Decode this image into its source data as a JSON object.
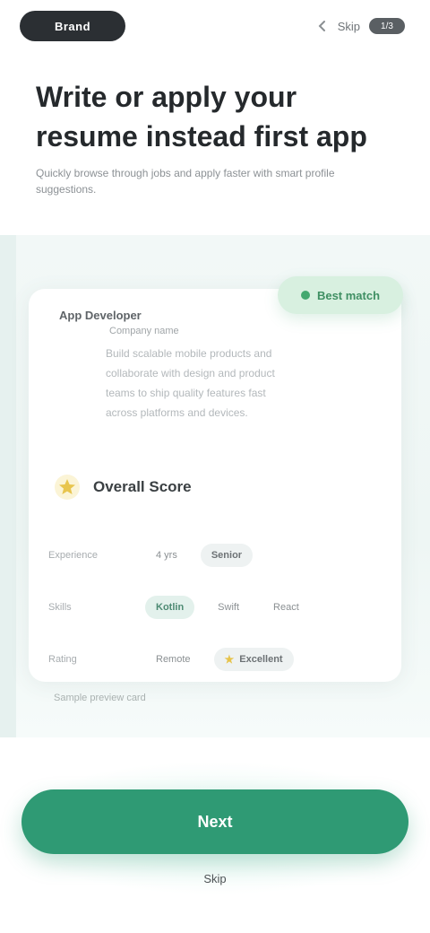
{
  "topbar": {
    "logo_text": "Brand",
    "link_text": "Skip",
    "pill_text": "1/3"
  },
  "heading": {
    "title": "Write or apply your resume instead first app",
    "subtitle": "Quickly browse through jobs and apply faster with smart profile suggestions."
  },
  "preview": {
    "badge_label": "Best match",
    "app_name": "App Developer",
    "app_meta": "Company name",
    "description_lines": [
      "Build scalable mobile products and",
      "collaborate with design and product",
      "teams to ship quality features fast",
      "across platforms and devices."
    ],
    "score_title": "Overall Score",
    "rows": [
      {
        "label": "Experience",
        "chips": [
          {
            "text": "4 yrs",
            "style": "plain"
          },
          {
            "text": "Senior",
            "style": "gray"
          }
        ]
      },
      {
        "label": "Skills",
        "chips": [
          {
            "text": "Kotlin",
            "style": "green"
          },
          {
            "text": "Swift",
            "style": "plain"
          },
          {
            "text": "React",
            "style": "plain"
          }
        ]
      },
      {
        "label": "Rating",
        "chips": [
          {
            "text": "Remote",
            "style": "plain"
          },
          {
            "text": "Excellent",
            "style": "gray",
            "star": true
          }
        ]
      }
    ],
    "caption": "Sample preview card"
  },
  "cta": {
    "button_label": "Next",
    "footer_link": "Skip"
  },
  "colors": {
    "primary": "#2f9a74",
    "badge_bg": "#d8f0e0",
    "panel_bg": "#f2f8f7",
    "logo_bg": "#2b2f33"
  },
  "icons": {
    "topbar": "chevron-left-icon",
    "score": "star-icon",
    "badge": "dot-icon"
  }
}
